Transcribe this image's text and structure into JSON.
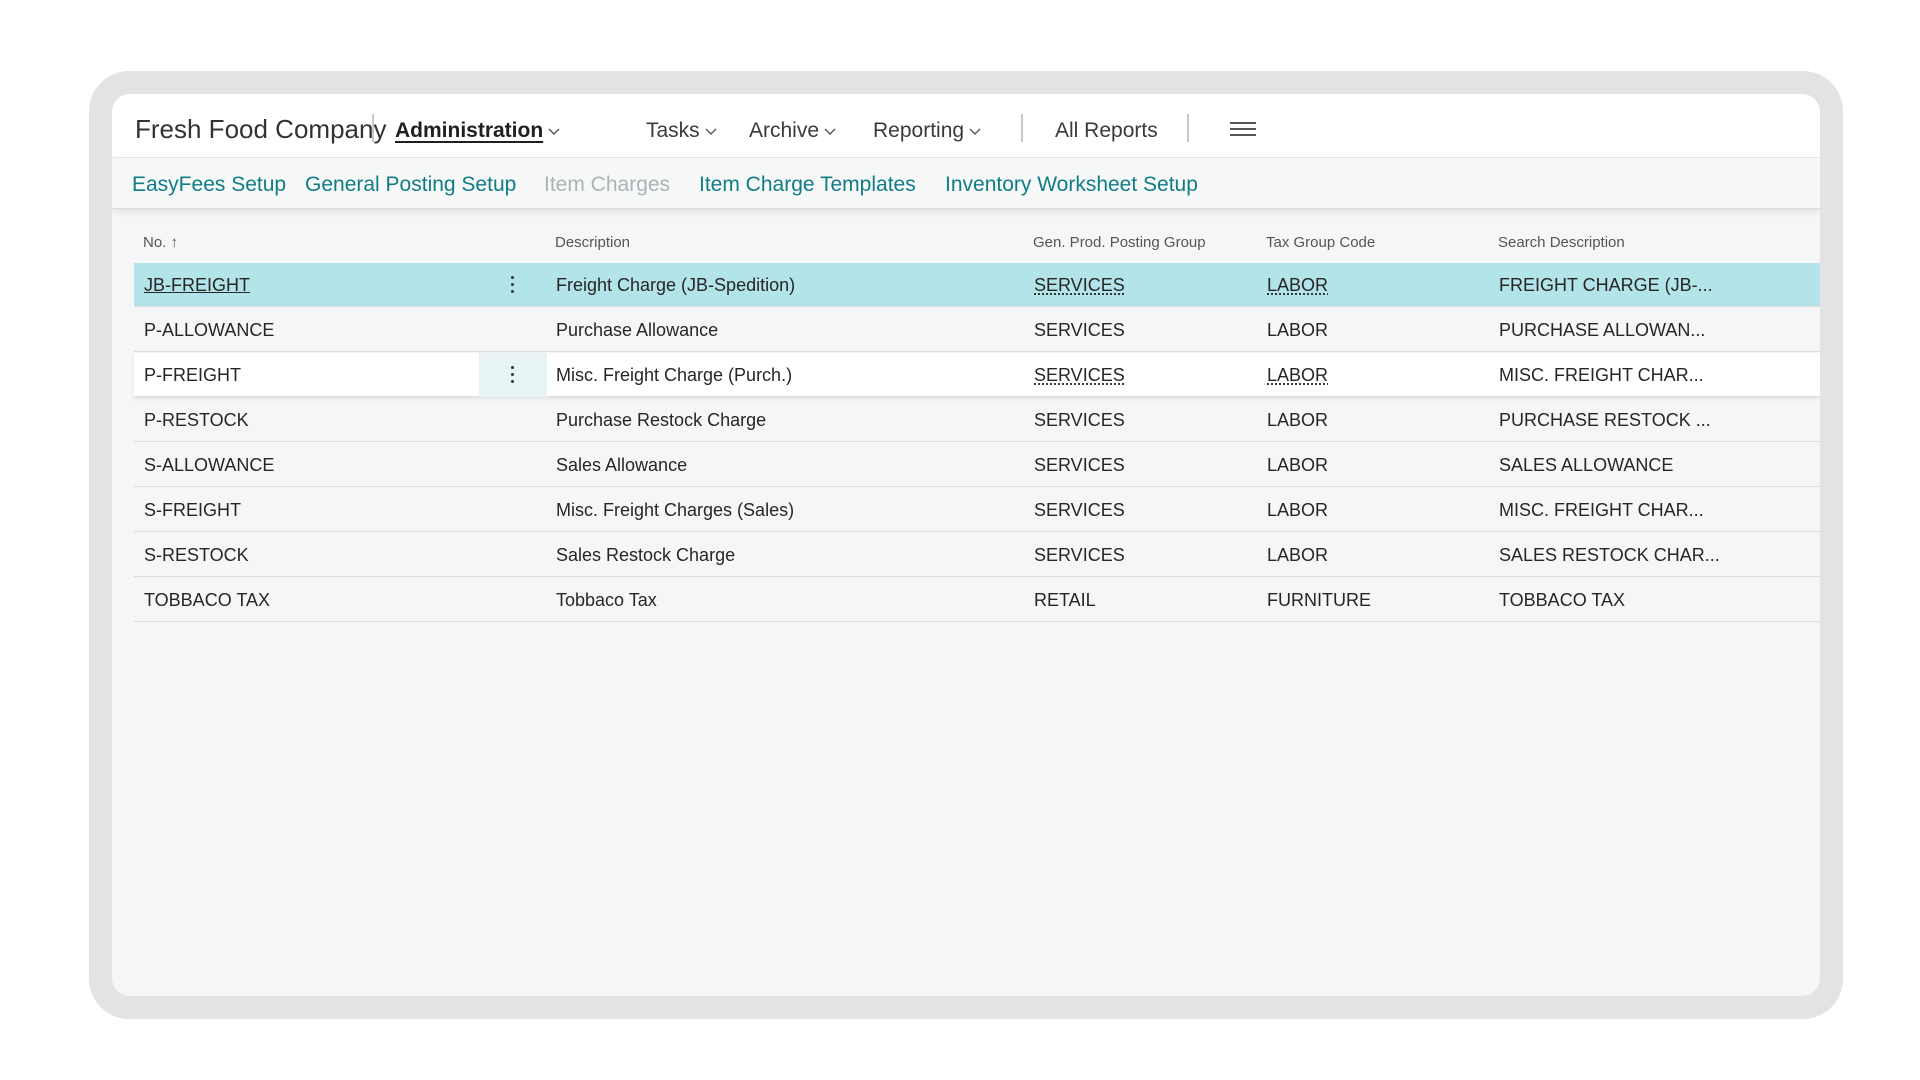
{
  "app": {
    "company": "Fresh Food Company",
    "nav": [
      {
        "label": "Administration",
        "active": true,
        "dropdown": true
      },
      {
        "label": "Tasks",
        "dropdown": true
      },
      {
        "label": "Archive",
        "dropdown": true
      },
      {
        "label": "Reporting",
        "dropdown": true
      },
      {
        "label": "All Reports",
        "dropdown": false
      }
    ],
    "menu_icon": "hamburger-menu-icon"
  },
  "actions": [
    {
      "label": "EasyFees Setup",
      "enabled": true
    },
    {
      "label": "General Posting Setup",
      "enabled": true
    },
    {
      "label": "Item Charges",
      "enabled": false
    },
    {
      "label": "Item Charge Templates",
      "enabled": true
    },
    {
      "label": "Inventory Worksheet Setup",
      "enabled": true
    }
  ],
  "table": {
    "columns": [
      "No. ↑",
      "Description",
      "Gen. Prod. Posting Group",
      "Tax Group Code",
      "Search Description"
    ],
    "rows": [
      {
        "no": "JB-FREIGHT",
        "description": "Freight Charge (JB-Spedition)",
        "gen_prod": "SERVICES",
        "tax_group": "LABOR",
        "search": "FREIGHT CHARGE (JB-..."
      },
      {
        "no": "P-ALLOWANCE",
        "description": "Purchase Allowance",
        "gen_prod": "SERVICES",
        "tax_group": "LABOR",
        "search": "PURCHASE ALLOWAN..."
      },
      {
        "no": "P-FREIGHT",
        "description": "Misc. Freight Charge (Purch.)",
        "gen_prod": "SERVICES",
        "tax_group": "LABOR",
        "search": "MISC. FREIGHT CHAR..."
      },
      {
        "no": "P-RESTOCK",
        "description": "Purchase Restock Charge",
        "gen_prod": "SERVICES",
        "tax_group": "LABOR",
        "search": "PURCHASE RESTOCK ..."
      },
      {
        "no": "S-ALLOWANCE",
        "description": "Sales Allowance",
        "gen_prod": "SERVICES",
        "tax_group": "LABOR",
        "search": "SALES ALLOWANCE"
      },
      {
        "no": "S-FREIGHT",
        "description": "Misc. Freight Charges (Sales)",
        "gen_prod": "SERVICES",
        "tax_group": "LABOR",
        "search": "MISC. FREIGHT CHAR..."
      },
      {
        "no": "S-RESTOCK",
        "description": "Sales Restock Charge",
        "gen_prod": "SERVICES",
        "tax_group": "LABOR",
        "search": "SALES RESTOCK CHAR..."
      },
      {
        "no": "TOBBACO TAX",
        "description": "Tobbaco Tax",
        "gen_prod": "RETAIL",
        "tax_group": "FURNITURE",
        "search": "TOBBACO TAX"
      }
    ]
  },
  "colors": {
    "accent": "#107c86",
    "selected_row": "#b3e4e9",
    "disabled_action": "#a9b4b6"
  }
}
